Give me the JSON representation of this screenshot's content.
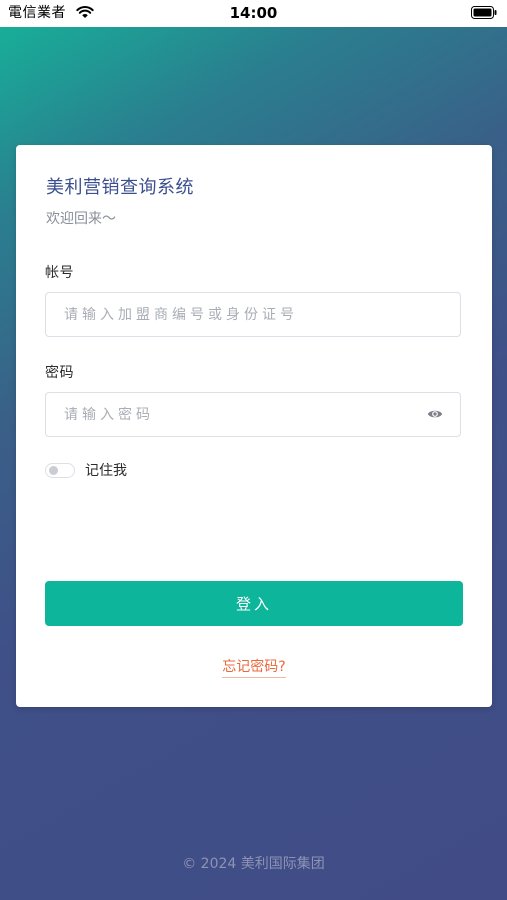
{
  "status_bar": {
    "carrier": "電信業者",
    "time": "14:00",
    "wifi_icon": "wifi-icon",
    "battery_icon": "battery-icon"
  },
  "login": {
    "title": "美利营销查询系统",
    "subtitle": "欢迎回来～",
    "account_label": "帐号",
    "account_placeholder": "请输入加盟商编号或身份证号",
    "account_value": "",
    "password_label": "密码",
    "password_placeholder": "请输入密码",
    "password_value": "",
    "password_toggle_icon": "eye-icon",
    "remember_label": "记住我",
    "remember_checked": false,
    "login_button": "登入",
    "forgot_link": "忘记密码?"
  },
  "footer": {
    "copyright": "© 2024 美利国际集团"
  },
  "colors": {
    "primary": "#0db59a",
    "title": "#3b4f8f",
    "link": "#e8693d",
    "gradient_top": "#15b59a",
    "gradient_bottom": "#414c86"
  }
}
